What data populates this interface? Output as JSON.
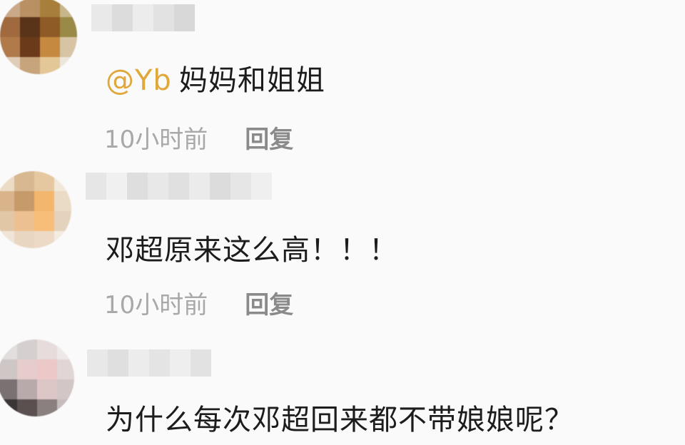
{
  "comments": [
    {
      "mention": "@Yb",
      "text": "妈妈和姐姐",
      "time": "10小时前",
      "reply_label": "回复"
    },
    {
      "mention": "",
      "text": "邓超原来这么高！！！",
      "time": "10小时前",
      "reply_label": "回复"
    },
    {
      "mention": "",
      "text": "为什么每次邓超回来都不带娘娘呢？",
      "time": "",
      "reply_label": ""
    }
  ],
  "colors": {
    "background": "#fafafa",
    "mention": "#e0a83a",
    "text": "#1c1c1c",
    "timestamp": "#a8a8a8",
    "reply": "#8a8a8a"
  }
}
